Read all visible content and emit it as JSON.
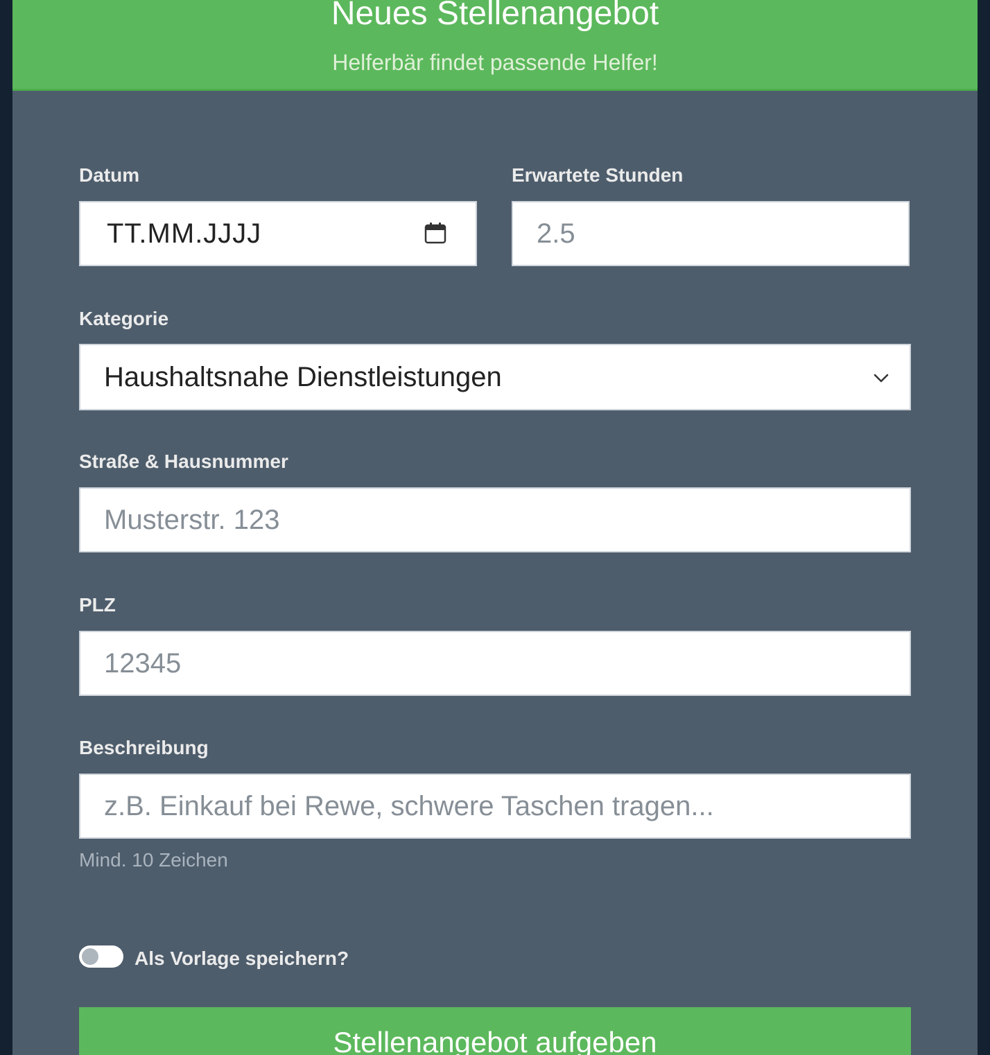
{
  "header": {
    "title": "Neues Stellenangebot",
    "subtitle": "Helferbär findet passende Helfer!"
  },
  "form": {
    "date": {
      "label": "Datum",
      "value": "TT.MM.JJJJ",
      "icon": "calendar-icon"
    },
    "hours": {
      "label": "Erwartete Stunden",
      "placeholder": "2.5"
    },
    "category": {
      "label": "Kategorie",
      "selected": "Haushaltsnahe Dienstleistungen",
      "icon": "chevron-down-icon"
    },
    "street": {
      "label": "Straße & Hausnummer",
      "placeholder": "Musterstr. 123"
    },
    "zip": {
      "label": "PLZ",
      "placeholder": "12345"
    },
    "description": {
      "label": "Beschreibung",
      "placeholder": "z.B. Einkauf bei Rewe, schwere Taschen tragen...",
      "help": "Mind. 10 Zeichen"
    },
    "template_toggle": {
      "label": "Als Vorlage speichern?",
      "checked": false
    },
    "submit_label": "Stellenangebot aufgeben"
  },
  "colors": {
    "primary_green": "#5cb85c",
    "card_background": "#4e5d6c",
    "page_background": "#132130"
  }
}
